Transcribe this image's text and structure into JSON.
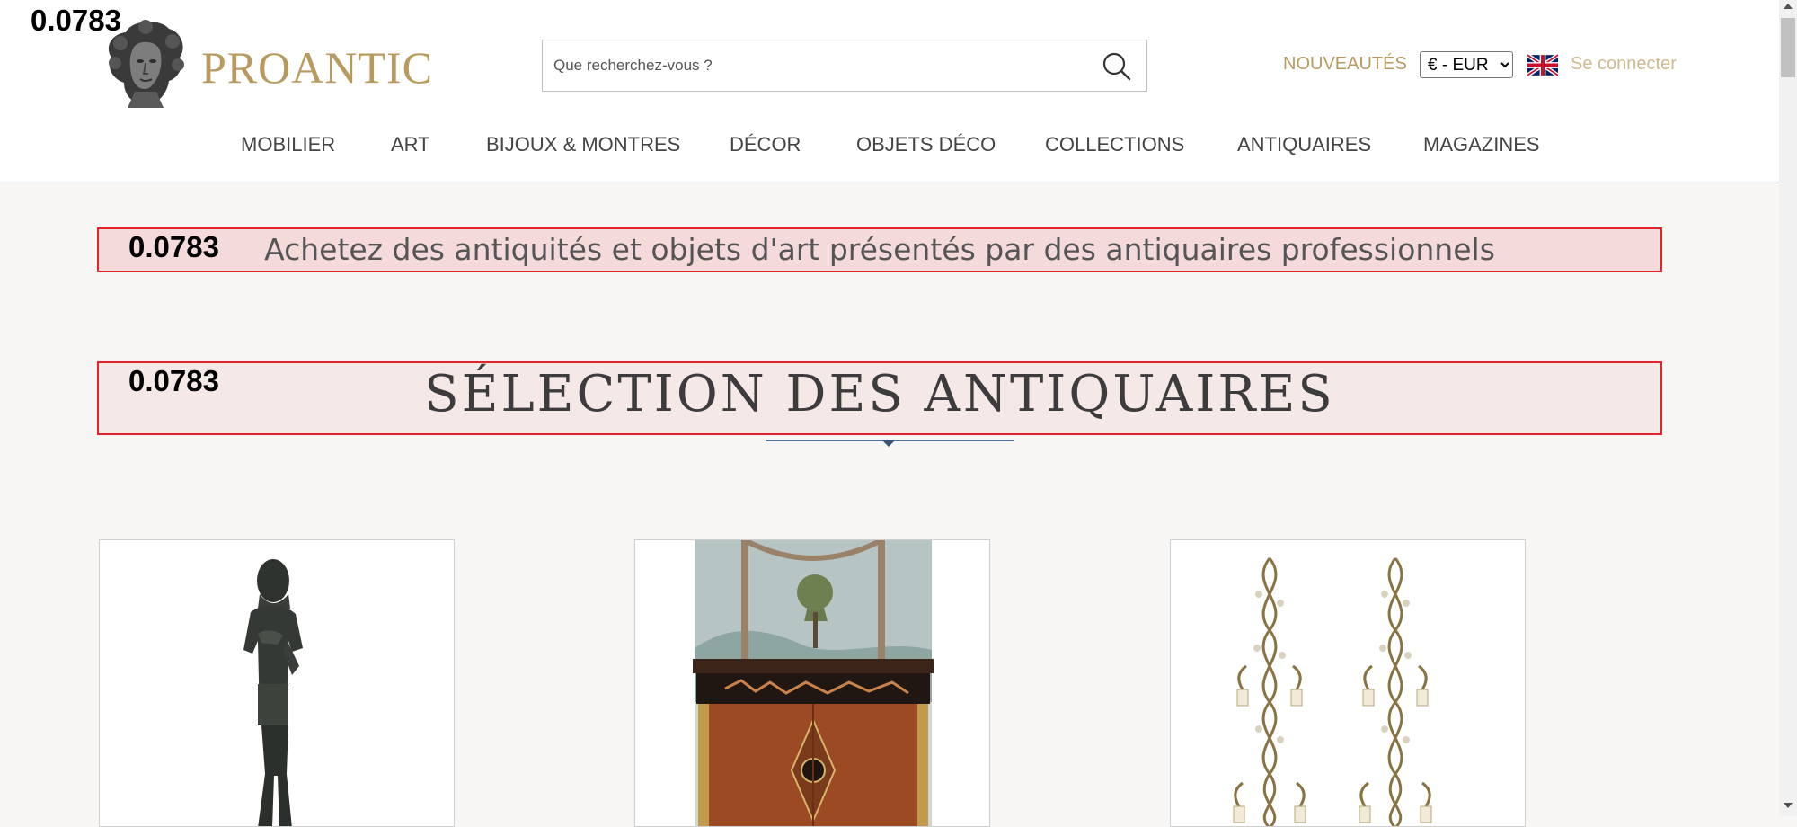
{
  "debug": {
    "score": "0.0783"
  },
  "brand": {
    "name": "PROANTIC",
    "logo_icon": "greek-bust-logo"
  },
  "search": {
    "placeholder": "Que recherchez-vous ?",
    "icon": "search-icon"
  },
  "top_links": {
    "nouveautes": "NOUVEAUTÉS",
    "currency": "€ - EUR",
    "language_flag": "uk-flag-icon",
    "login": "Se connecter"
  },
  "nav": {
    "items": [
      {
        "label": "MOBILIER"
      },
      {
        "label": "ART"
      },
      {
        "label": "BIJOUX & MONTRES"
      },
      {
        "label": "DÉCOR"
      },
      {
        "label": "OBJETS DÉCO"
      },
      {
        "label": "COLLECTIONS"
      },
      {
        "label": "ANTIQUAIRES"
      },
      {
        "label": "MAGAZINES"
      }
    ]
  },
  "main": {
    "tagline": "Achetez des antiquités et objets d'art présentés par des antiquaires professionnels",
    "section_title": "SÉLECTION DES ANTIQUAIRES"
  },
  "colors": {
    "brand_gold": "#b89a5e",
    "login_gold": "#cfb98f",
    "highlight_red": "#e3242b",
    "underline_blue": "#51709a",
    "page_bg": "#f7f6f4"
  }
}
